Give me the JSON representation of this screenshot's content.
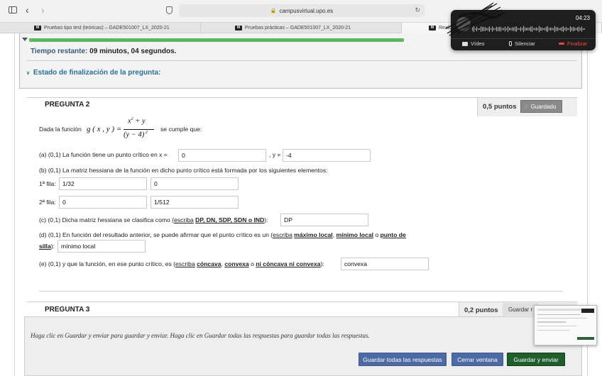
{
  "browser": {
    "url": "campusvirtual.upo.es",
    "tabs": [
      {
        "label": "Pruebas tipo test (teóricas) – GADE501007_LX_2020-21",
        "icon": "moodle"
      },
      {
        "label": "Pruebas prácticas – GADE501007_LX_2020-21",
        "icon": "moodle"
      },
      {
        "label": "Realiz",
        "icon": "moodle"
      }
    ]
  },
  "timer": {
    "label": "Tiempo restante:",
    "value": "09 minutos, 04 segundos.",
    "progress": 1.0,
    "estado_label": "Estado de finalización de la pregunta:"
  },
  "question2": {
    "title": "PREGUNTA 2",
    "points": "0,5 puntos",
    "status": "Guardado",
    "intro_before": "Dada la función",
    "intro_after": "se cumple que:",
    "a_label": "(a) (0,1) La función tiene un punto crítico en x =",
    "a_y_label": ", y =",
    "a_x_value": "0",
    "a_y_value": "-4",
    "b_label": "(b) (0,1) La matriz hessiana de la función en dicho punto crítico está formada por los siguientes elementos:",
    "row1_label": "1ª fila:",
    "row1_values": [
      "1/32",
      "0"
    ],
    "row2_label": "2ª fila:",
    "row2_values": [
      "0",
      "1/512"
    ],
    "c_label_1": "(c) (0,1) Dicha matriz hessiana se clasifica como (",
    "c_escriba": "escriba",
    "c_options": "DP, DN, SDP, SDN o IND",
    "c_value": "DP",
    "d_label_1": "(d) (0,1) En función del resultado anterior, se puede afirmar que el punto crítico es un (",
    "d_escriba": "escriba",
    "d_opt1": "máximo local",
    "d_opt2": "mínimo local",
    "d_o": "o",
    "d_opt3a": "punto de",
    "d_opt3b": "silla",
    "d_value": "mínimo local",
    "e_label_1": "(e) (0,1) y que la función, en ese punto crítico, es (",
    "e_escriba": "escriba",
    "e_opt1": "cóncava",
    "e_opt2": "convexa",
    "e_o": "o",
    "e_opt3": "ni cóncava ni convexa",
    "e_value": "convexa"
  },
  "question3": {
    "title": "PREGUNTA 3",
    "points": "0,2 puntos",
    "status_partial": "Guardar r"
  },
  "footer": {
    "instructions": "Haga clic en Guardar y enviar para guardar y enviar. Haga clic en Guardar todas las respuestas para guardar todas las respuestas.",
    "save_all": "Guardar todas las respuestas",
    "close": "Cerrar ventana",
    "save_submit": "Guardar y enviar"
  },
  "call": {
    "timer": "04:23",
    "video": "Vídeo",
    "mute": "Silenciar",
    "end": "Finalizar"
  },
  "colors": {
    "accent_blue": "#2a6f97",
    "progress_green": "#5cb85c",
    "btn_blue": "#4d6aa3",
    "btn_green": "#1e5e2c",
    "end_red": "#ff453a"
  }
}
